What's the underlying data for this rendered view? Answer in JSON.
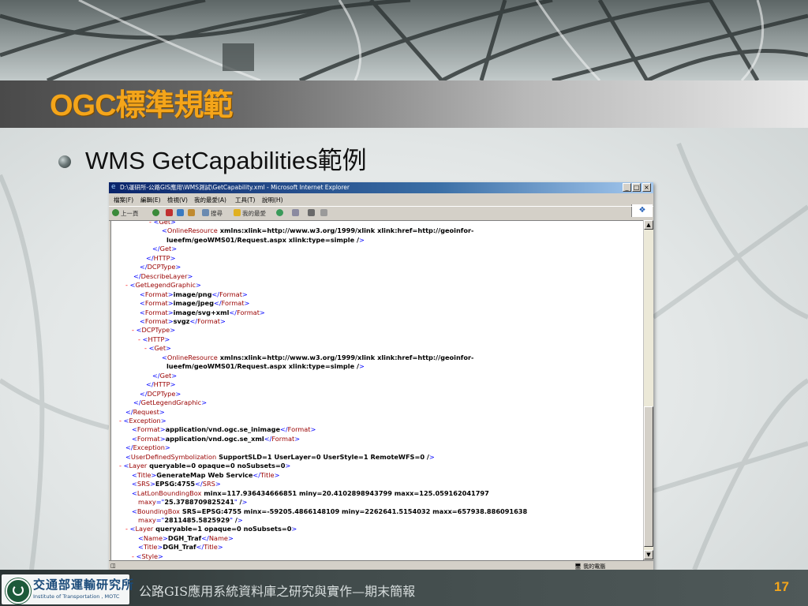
{
  "slide": {
    "title": "OGC標準規範",
    "bullet": "WMS GetCapabilities範例",
    "footer_text": "公路GIS應用系統資料庫之研究與實作—期末簡報",
    "page_number": "17",
    "org_name": "交通部運輸研究所",
    "org_sub": "Institute of Transportation , MOTC"
  },
  "browser": {
    "title": "D:\\運研所-公路GIS應用\\WMS測試\\GetCapability.xml - Microsoft Internet Explorer",
    "menu": [
      "檔案(F)",
      "編輯(E)",
      "檢視(V)",
      "我的最愛(A)",
      "工具(T)",
      "說明(H)"
    ],
    "toolbar": {
      "back": "上一頁",
      "search": "搜尋",
      "favorites": "我的最愛"
    },
    "status_zone": "我的電腦",
    "xml_lines": [
      "- <Get>",
      "<OnlineResource xmlns:xlink=\"http://www.w3.org/1999/xlink\" xlink:href=\"http://geoinfor-",
      "lueefm/geoWMS01/Request.aspx\" xlink:type=\"simple\" />",
      "</Get>",
      "</HTTP>",
      "</DCPType>",
      "</DescribeLayer>",
      "- <GetLegendGraphic>",
      "<Format>image/png</Format>",
      "<Format>image/jpeg</Format>",
      "<Format>image/svg+xml</Format>",
      "<Format>svgz</Format>",
      "- <DCPType>",
      "- <HTTP>",
      "- <Get>",
      "<OnlineResource xmlns:xlink=\"http://www.w3.org/1999/xlink\" xlink:href=\"http://geoinfor-",
      "lueefm/geoWMS01/Request.aspx\" xlink:type=\"simple\" />",
      "</Get>",
      "</HTTP>",
      "</DCPType>",
      "</GetLegendGraphic>",
      "</Request>",
      "- <Exception>",
      "<Format>application/vnd.ogc.se_inimage</Format>",
      "<Format>application/vnd.ogc.se_xml</Format>",
      "</Exception>",
      "<UserDefinedSymbolization SupportSLD=\"1\" UserLayer=\"0\" UserStyle=\"1\" RemoteWFS=\"0\" />",
      "- <Layer queryable=\"0\" opaque=\"0\" noSubsets=\"0\">",
      "<Title>GenerateMap Web Service</Title>",
      "<SRS>EPSG:4755</SRS>",
      "<LatLonBoundingBox minx=\"117.936434666851\" miny=\"20.4102898943799\" maxx=\"125.059162041797\"",
      "maxy=\"25.3788709825241\" />",
      "<BoundingBox SRS=\"EPSG:4755\" minx=\"-59205.4866148109\" miny=\"2262641.5154032\" maxx=\"657938.886091638\"",
      "maxy=\"2811485.5825929\" />",
      "- <Layer queryable=\"1\" opaque=\"0\" noSubsets=\"0\">",
      "<Name>DGH_Traf</Name>",
      "<Title>DGH_Traf</Title>",
      "- <Style>"
    ]
  }
}
